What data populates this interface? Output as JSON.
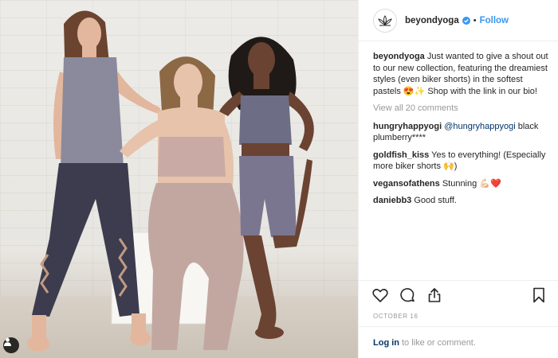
{
  "header": {
    "username": "beyondyoga",
    "dot": "•",
    "follow_label": "Follow"
  },
  "caption": {
    "username": "beyondyoga",
    "text": "Just wanted to give a shout out to our new collection, featuring the dreamiest styles (even biker shorts) in the softest pastels 😍✨ Shop with the link in our bio!"
  },
  "view_all_label": "View all 20 comments",
  "comments": [
    {
      "user": "hungryhappyogi",
      "mention": "@hungryhappyogi",
      "text": " black plumberry****"
    },
    {
      "user": "goldfish_kiss",
      "text": "Yes to everything! (Especially more biker shorts 🙌)"
    },
    {
      "user": "vegansofathens",
      "text": "Stunning 💪🏻❤️"
    },
    {
      "user": "daniebb3",
      "text": "Good stuff."
    }
  ],
  "date": "OCTOBER 16",
  "login": {
    "link": "Log in",
    "text": "to like or comment."
  },
  "icons": {
    "avatar": "lotus-logo-icon",
    "verified": "verified-badge-icon",
    "like": "heart-icon",
    "comment": "comment-bubble-icon",
    "share": "share-icon",
    "save": "bookmark-icon",
    "user_tag": "user-tag-icon"
  },
  "colors": {
    "link_blue": "#3897f0",
    "mention_blue": "#003569",
    "muted": "#999999",
    "text": "#262626"
  }
}
